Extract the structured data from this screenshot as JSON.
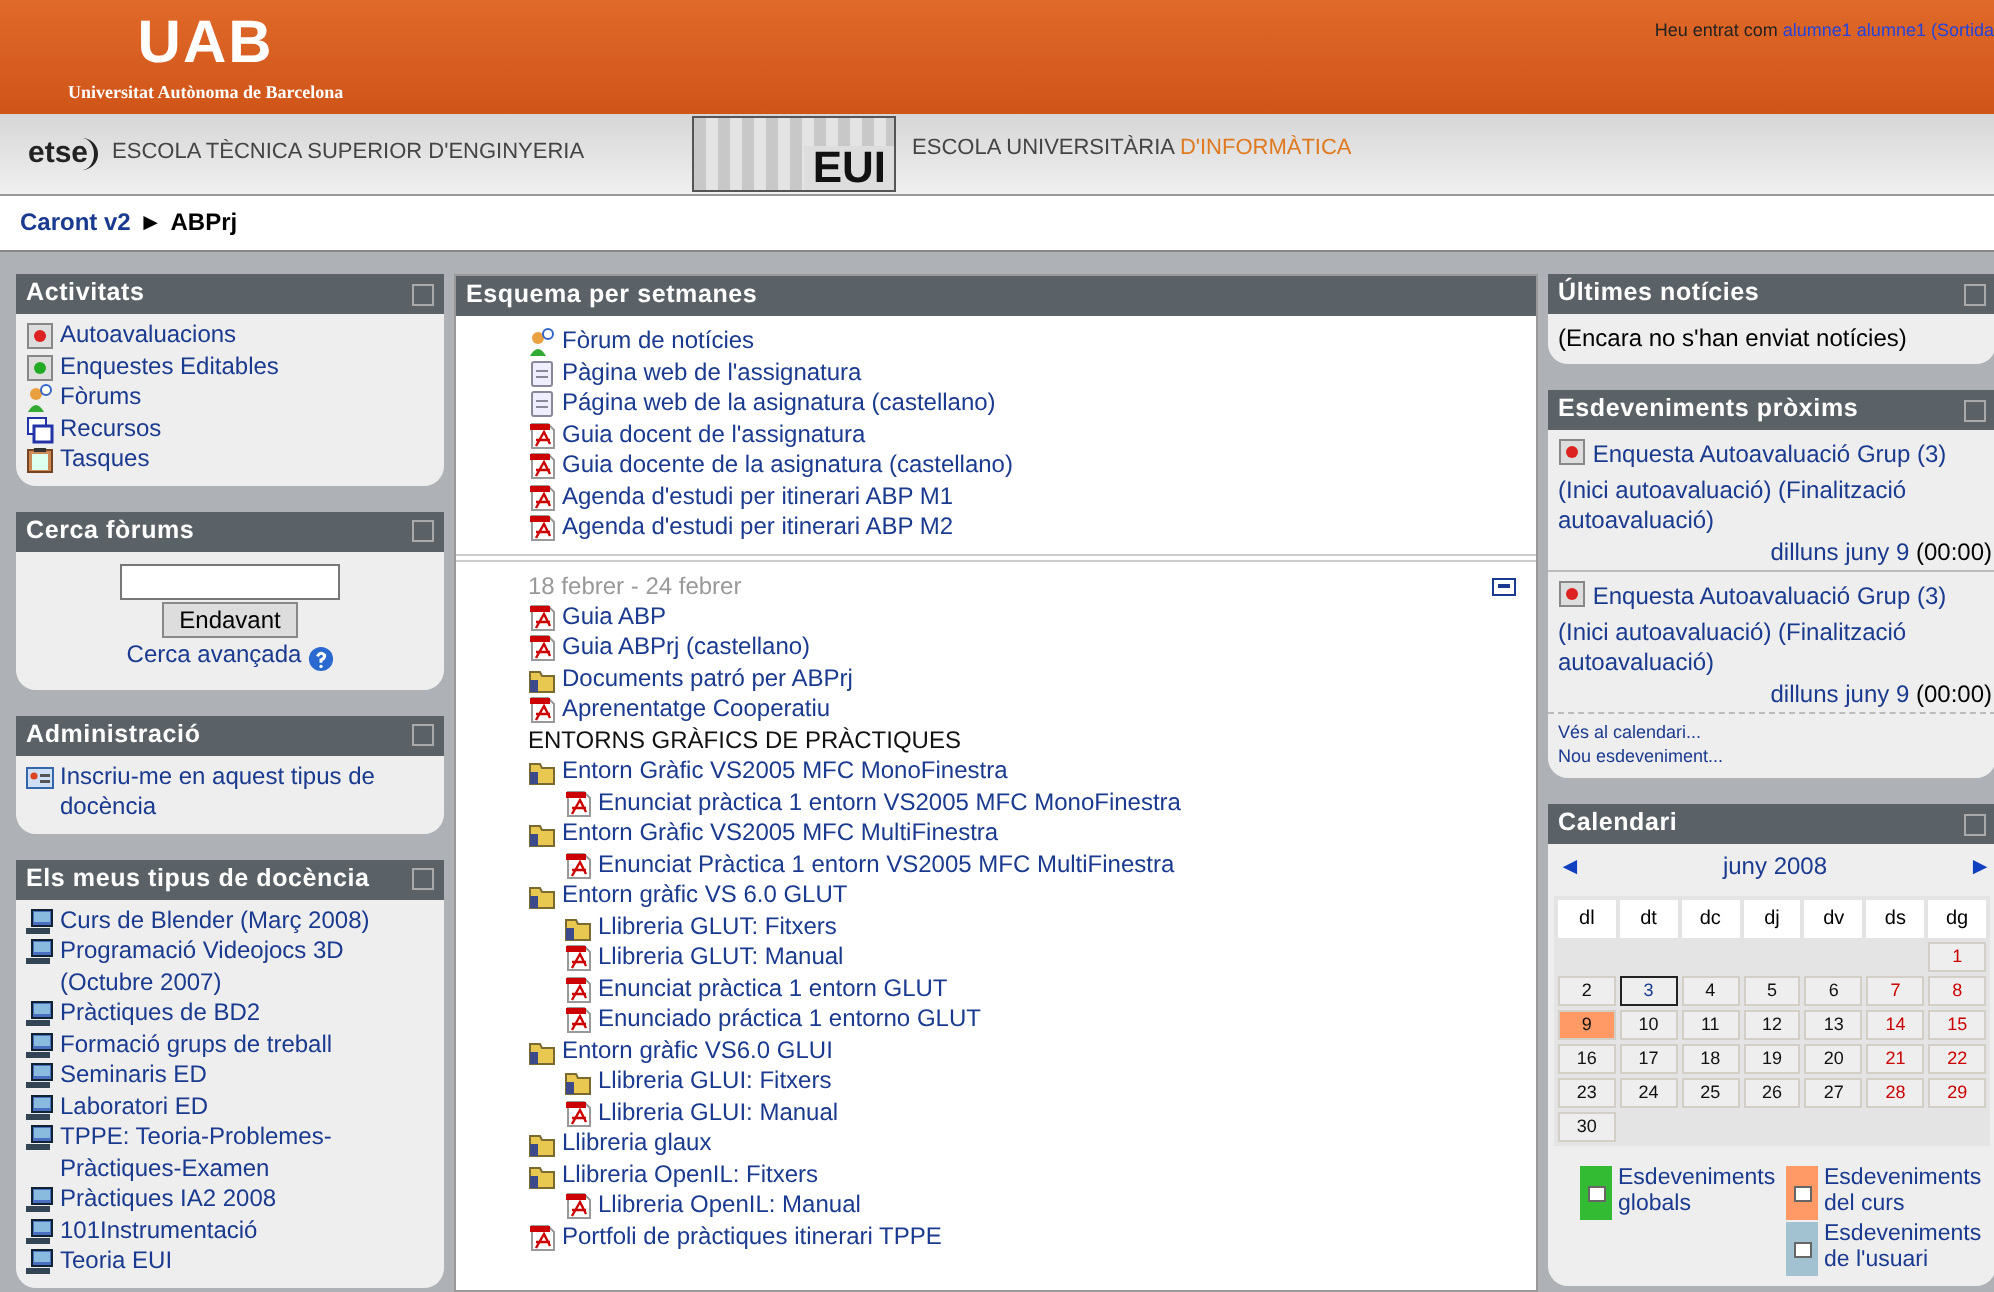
{
  "header": {
    "logo": "UAB",
    "university": "Universitat Autònoma de Barcelona",
    "login": {
      "prefix": "Heu entrat com",
      "user": "alumne1 alumne1",
      "suffix": "(Sortida"
    }
  },
  "schools": {
    "etse_logo": "etse",
    "etse_name": "ESCOLA TÈCNICA SUPERIOR D'ENGINYERIA",
    "eui_logo": "EUI",
    "eui_name": "ESCOLA UNIVERSITÀRIA",
    "eui_highlight": "D'INFORMÀTICA"
  },
  "breadcrumb": {
    "home": "Caront v2",
    "separator": "►",
    "current": "ABPrj"
  },
  "left_blocks": [
    {
      "kind": "list",
      "title": "Activitats",
      "items": [
        {
          "kind": "survey",
          "label": "Autoavaluacions"
        },
        {
          "kind": "survey_green",
          "label": "Enquestes Editables"
        },
        {
          "kind": "forum",
          "label": "Fòrums"
        },
        {
          "kind": "resource",
          "label": "Recursos"
        },
        {
          "kind": "assignment",
          "label": "Tasques"
        }
      ]
    },
    {
      "kind": "search",
      "title": "Cerca fòrums",
      "button": "Endavant",
      "advanced": "Cerca avançada"
    },
    {
      "kind": "list",
      "title": "Administració",
      "items": [
        {
          "kind": "enrol",
          "label": "Inscriu-me en aquest tipus de docència"
        }
      ]
    },
    {
      "kind": "list",
      "title": "Els meus tipus de docència",
      "items": [
        {
          "kind": "course",
          "label": "Curs de Blender (Març 2008)"
        },
        {
          "kind": "course",
          "label": "Programació Videojocs 3D (Octubre 2007)"
        },
        {
          "kind": "course",
          "label": "Pràctiques de BD2"
        },
        {
          "kind": "course",
          "label": "Formació grups de treball"
        },
        {
          "kind": "course",
          "label": "Seminaris ED"
        },
        {
          "kind": "course",
          "label": "Laboratori ED"
        },
        {
          "kind": "course",
          "label": "TPPE: Teoria-Problemes-Pràctiques-Examen"
        },
        {
          "kind": "course",
          "label": "Pràctiques IA2 2008"
        },
        {
          "kind": "course",
          "label": "101Instrumentació"
        },
        {
          "kind": "course",
          "label": "Teoria EUI"
        }
      ]
    }
  ],
  "main": {
    "title": "Esquema per setmanes",
    "sections": [
      {
        "items": [
          {
            "kind": "forum",
            "label": "Fòrum de notícies"
          },
          {
            "kind": "page",
            "label": "Pàgina web de l'assignatura"
          },
          {
            "kind": "page",
            "label": "Página web de la asignatura (castellano)"
          },
          {
            "kind": "pdf",
            "label": "Guia docent de l'assignatura"
          },
          {
            "kind": "pdf",
            "label": "Guia docente de la asignatura (castellano)"
          },
          {
            "kind": "pdf",
            "label": "Agenda d'estudi per itinerari ABP M1"
          },
          {
            "kind": "pdf",
            "label": "Agenda d'estudi per itinerari ABP M2"
          }
        ]
      },
      {
        "date": "18 febrer - 24 febrer",
        "items": [
          {
            "kind": "pdf",
            "label": "Guia ABP"
          },
          {
            "kind": "pdf",
            "label": "Guia ABPrj (castellano)"
          },
          {
            "kind": "folder",
            "label": "Documents patró per ABPrj"
          },
          {
            "kind": "pdf",
            "label": "Aprenentatge Cooperatiu"
          },
          {
            "kind": "label",
            "label": "ENTORNS GRÀFICS DE PRÀCTIQUES"
          },
          {
            "kind": "folder",
            "label": "Entorn Gràfic VS2005 MFC MonoFinestra",
            "children": [
              {
                "kind": "pdf",
                "label": "Enunciat pràctica 1 entorn VS2005 MFC MonoFinestra"
              }
            ]
          },
          {
            "kind": "folder",
            "label": "Entorn Gràfic VS2005 MFC MultiFinestra",
            "children": [
              {
                "kind": "pdf",
                "label": "Enunciat Pràctica 1 entorn VS2005 MFC MultiFinestra"
              }
            ]
          },
          {
            "kind": "folder",
            "label": "Entorn gràfic VS 6.0 GLUT",
            "children": [
              {
                "kind": "folder",
                "label": "Llibreria GLUT: Fitxers"
              },
              {
                "kind": "pdf",
                "label": "Llibreria GLUT: Manual"
              },
              {
                "kind": "pdf",
                "label": "Enunciat pràctica 1 entorn GLUT"
              },
              {
                "kind": "pdf",
                "label": "Enunciado práctica 1 entorno GLUT"
              }
            ]
          },
          {
            "kind": "folder",
            "label": "Entorn gràfic VS6.0 GLUI",
            "children": [
              {
                "kind": "folder",
                "label": "Llibreria GLUI: Fitxers"
              },
              {
                "kind": "pdf",
                "label": "Llibreria GLUI: Manual"
              }
            ]
          },
          {
            "kind": "folder",
            "label": "Llibreria glaux"
          },
          {
            "kind": "folder",
            "label": "Llibreria OpenIL: Fitxers",
            "children": [
              {
                "kind": "pdf",
                "label": "Llibreria OpenIL: Manual"
              }
            ]
          },
          {
            "kind": "pdf",
            "label": "Portfoli de pràctiques itinerari TPPE"
          }
        ]
      }
    ]
  },
  "news": {
    "title": "Últimes notícies",
    "text": "(Encara no s'han enviat notícies)"
  },
  "events": {
    "title": "Esdeveniments pròxims",
    "items": [
      {
        "name": "Enquesta Autoavaluació Grup (3)",
        "detail": "(Inici autoavaluació) (Finalització autoavaluació)",
        "date": "dilluns juny 9",
        "time": "(00:00)"
      },
      {
        "name": "Enquesta Autoavaluació Grup (3)",
        "detail": "(Inici autoavaluació) (Finalització autoavaluació)",
        "date": "dilluns juny 9",
        "time": "(00:00)"
      }
    ],
    "links": [
      "Vés al calendari...",
      "Nou esdeveniment..."
    ]
  },
  "calendar": {
    "title": "Calendari",
    "prev": "◄",
    "month": "juny 2008",
    "next": "►",
    "weekdays": [
      "dl",
      "dt",
      "dc",
      "dj",
      "dv",
      "ds",
      "dg"
    ],
    "weeks": [
      [
        {
          "kind": "blank"
        },
        {
          "kind": "blank"
        },
        {
          "kind": "blank"
        },
        {
          "kind": "blank"
        },
        {
          "kind": "blank"
        },
        {
          "kind": "blank"
        },
        {
          "kind": "day",
          "day": "1",
          "weekend": true,
          "today": false,
          "event": false
        }
      ],
      [
        {
          "kind": "day",
          "day": "2",
          "weekend": false,
          "today": false,
          "event": false
        },
        {
          "kind": "day",
          "day": "3",
          "weekend": false,
          "today": true,
          "event": false
        },
        {
          "kind": "day",
          "day": "4",
          "weekend": false,
          "today": false,
          "event": false
        },
        {
          "kind": "day",
          "day": "5",
          "weekend": false,
          "today": false,
          "event": false
        },
        {
          "kind": "day",
          "day": "6",
          "weekend": false,
          "today": false,
          "event": false
        },
        {
          "kind": "day",
          "day": "7",
          "weekend": true,
          "today": false,
          "event": false
        },
        {
          "kind": "day",
          "day": "8",
          "weekend": true,
          "today": false,
          "event": false
        }
      ],
      [
        {
          "kind": "day",
          "day": "9",
          "weekend": false,
          "today": false,
          "event": true
        },
        {
          "kind": "day",
          "day": "10",
          "weekend": false,
          "today": false,
          "event": false
        },
        {
          "kind": "day",
          "day": "11",
          "weekend": false,
          "today": false,
          "event": false
        },
        {
          "kind": "day",
          "day": "12",
          "weekend": false,
          "today": false,
          "event": false
        },
        {
          "kind": "day",
          "day": "13",
          "weekend": false,
          "today": false,
          "event": false
        },
        {
          "kind": "day",
          "day": "14",
          "weekend": true,
          "today": false,
          "event": false
        },
        {
          "kind": "day",
          "day": "15",
          "weekend": true,
          "today": false,
          "event": false
        }
      ],
      [
        {
          "kind": "day",
          "day": "16",
          "weekend": false,
          "today": false,
          "event": false
        },
        {
          "kind": "day",
          "day": "17",
          "weekend": false,
          "today": false,
          "event": false
        },
        {
          "kind": "day",
          "day": "18",
          "weekend": false,
          "today": false,
          "event": false
        },
        {
          "kind": "day",
          "day": "19",
          "weekend": false,
          "today": false,
          "event": false
        },
        {
          "kind": "day",
          "day": "20",
          "weekend": false,
          "today": false,
          "event": false
        },
        {
          "kind": "day",
          "day": "21",
          "weekend": true,
          "today": false,
          "event": false
        },
        {
          "kind": "day",
          "day": "22",
          "weekend": true,
          "today": false,
          "event": false
        }
      ],
      [
        {
          "kind": "day",
          "day": "23",
          "weekend": false,
          "today": false,
          "event": false
        },
        {
          "kind": "day",
          "day": "24",
          "weekend": false,
          "today": false,
          "event": false
        },
        {
          "kind": "day",
          "day": "25",
          "weekend": false,
          "today": false,
          "event": false
        },
        {
          "kind": "day",
          "day": "26",
          "weekend": false,
          "today": false,
          "event": false
        },
        {
          "kind": "day",
          "day": "27",
          "weekend": false,
          "today": false,
          "event": false
        },
        {
          "kind": "day",
          "day": "28",
          "weekend": true,
          "today": false,
          "event": false
        },
        {
          "kind": "day",
          "day": "29",
          "weekend": true,
          "today": false,
          "event": false
        }
      ],
      [
        {
          "kind": "day",
          "day": "30",
          "weekend": false,
          "today": false,
          "event": false
        },
        {
          "kind": "blank"
        },
        {
          "kind": "blank"
        },
        {
          "kind": "blank"
        },
        {
          "kind": "blank"
        },
        {
          "kind": "blank"
        },
        {
          "kind": "blank"
        }
      ]
    ],
    "legend": [
      {
        "label": "Esdeveniments globals",
        "color": "#33bb33"
      },
      {
        "label": "Esdeveniments del curs",
        "color": "#ff9966"
      },
      {
        "label": "Esdeveniments de l'usuari",
        "color": "#a3c2d1"
      }
    ]
  }
}
